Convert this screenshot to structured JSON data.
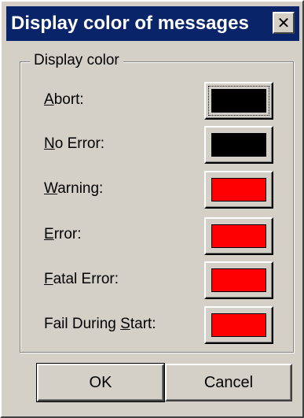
{
  "window": {
    "title": "Display color of messages",
    "close_glyph": "✕"
  },
  "group": {
    "label": "Display color"
  },
  "rows": [
    {
      "pre": "",
      "key": "A",
      "post": "bort:",
      "color": "#000000",
      "focused": true,
      "swatch_color": "#000000"
    },
    {
      "pre": "",
      "key": "N",
      "post": "o Error:",
      "color": "#000000"
    },
    {
      "pre": "",
      "key": "W",
      "post": "arning:",
      "color": "#ff0000"
    },
    {
      "pre": "",
      "key": "E",
      "post": "rror:",
      "color": "#ff0000"
    },
    {
      "pre": "",
      "key": "F",
      "post": "atal Error:",
      "color": "#ff0000"
    },
    {
      "pre": "Fail During ",
      "key": "S",
      "post": "tart:",
      "color": "#ff0000"
    }
  ],
  "buttons": {
    "ok_label": "OK",
    "cancel_label": "Cancel"
  },
  "colors": {
    "titlebar": "#0a246a",
    "face": "#d4d0c8",
    "red": "#ff0000",
    "black": "#000000"
  }
}
